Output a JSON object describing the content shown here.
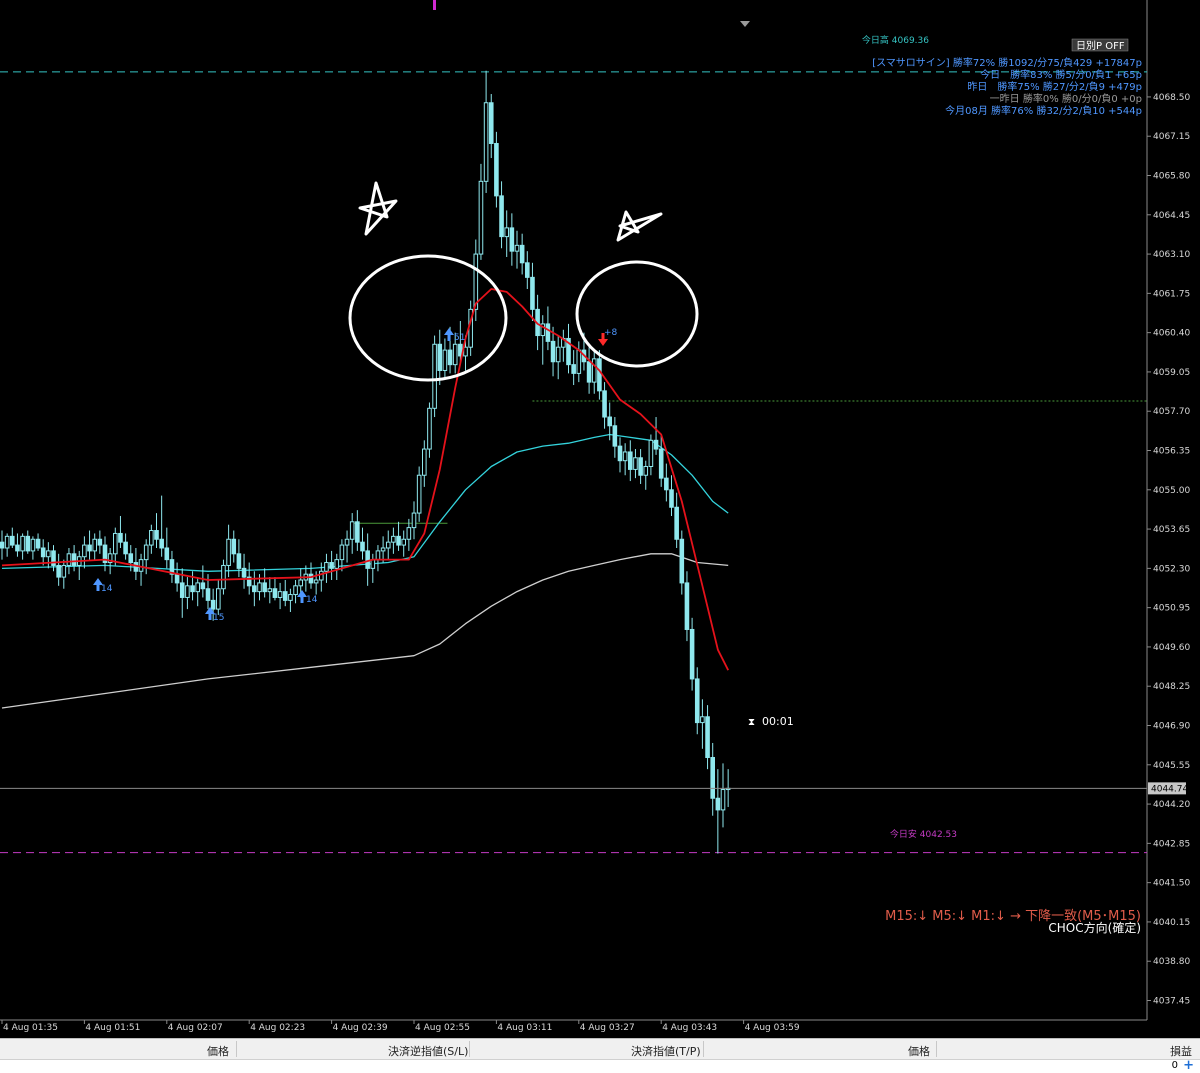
{
  "colors": {
    "background": "#000000",
    "candle": "#8fe8ee",
    "ma_fast": "#e5121b",
    "ma_mid": "#34d3dc",
    "ma_slow": "#cfcfcf",
    "day_high_line": "#35c3c3",
    "day_low_line": "#c43bc4",
    "buy_arrow": "#4f97ff",
    "sell_arrow": "#ff2a2a",
    "annotation": "#ffffff",
    "level_line": "#4a9a3a",
    "stats_text": "#4f97ff",
    "trend_text": "#e05c4a"
  },
  "top_controls": {
    "period_toggle": "日別P OFF"
  },
  "day_levels": {
    "high_label": "今日高 4069.36",
    "low_label": "今日安 4042.53"
  },
  "stats_panel": {
    "lines": [
      "[スマサロサイン] 勝率72% 勝1092/分75/負429 +17847p",
      "今日　勝率83% 勝5/分0/負1 +65p",
      "昨日　勝率75% 勝27/分2/負9 +479p",
      "一昨日 勝率0% 勝0/分0/負0 +0p",
      "今月08月 勝率76% 勝32/分2/負10 +544p"
    ]
  },
  "trend_panel": {
    "line1": "M15:↓ M5:↓ M1:↓ → 下降一致(M5･M15)",
    "line2": "CHOC方向(確定)"
  },
  "current_price_label": "4044.74",
  "countdown": "00:01",
  "signal_labels": {
    "buy_1": "14",
    "buy_2": "15",
    "buy_3": "14",
    "buy_4": "51",
    "sell_1": "+8"
  },
  "bottom_bar": {
    "col1": "価格",
    "col2": "決済逆指値(S/L)",
    "col3": "決済指値(T/P)",
    "col4": "価格",
    "col5": "損益",
    "profit_value": "0",
    "add_icon": "+"
  },
  "chart_data": {
    "type": "candlestick",
    "symbol_unit": "price",
    "price_ticks": [
      "4068.50",
      "4067.15",
      "4065.80",
      "4064.45",
      "4063.10",
      "4061.75",
      "4060.40",
      "4059.05",
      "4057.70",
      "4056.35",
      "4055.00",
      "4053.65",
      "4052.30",
      "4050.95",
      "4049.60",
      "4048.25",
      "4046.90",
      "4045.55",
      "4044.20",
      "4042.85",
      "4041.50",
      "4040.15",
      "4038.80",
      "4037.45"
    ],
    "ylim": [
      4036.78,
      4070.8
    ],
    "time_ticks": [
      "4 Aug 01:35",
      "4 Aug 01:51",
      "4 Aug 02:07",
      "4 Aug 02:23",
      "4 Aug 02:39",
      "4 Aug 02:55",
      "4 Aug 03:11",
      "4 Aug 03:27",
      "4 Aug 03:43",
      "4 Aug 03:59"
    ],
    "x_range_minutes": [
      "01:35",
      "04:08"
    ],
    "ohlc_minutes_from_0135": [
      [
        0,
        4053.2,
        4053.6,
        4052.6,
        4053.0
      ],
      [
        1,
        4053.0,
        4053.5,
        4052.7,
        4053.4
      ],
      [
        2,
        4053.4,
        4053.7,
        4053.0,
        4053.1
      ],
      [
        3,
        4053.1,
        4053.5,
        4052.7,
        4052.9
      ],
      [
        4,
        4052.9,
        4053.5,
        4052.6,
        4053.4
      ],
      [
        5,
        4053.4,
        4053.6,
        4052.8,
        4052.9
      ],
      [
        6,
        4052.9,
        4053.4,
        4052.6,
        4053.3
      ],
      [
        7,
        4053.3,
        4053.5,
        4052.9,
        4053.0
      ],
      [
        8,
        4053.0,
        4053.3,
        4052.4,
        4052.7
      ],
      [
        9,
        4052.7,
        4053.2,
        4052.3,
        4052.9
      ],
      [
        10,
        4052.9,
        4053.1,
        4052.2,
        4052.4
      ],
      [
        11,
        4052.4,
        4052.8,
        4051.7,
        4052.0
      ],
      [
        12,
        4052.0,
        4052.6,
        4051.6,
        4052.4
      ],
      [
        13,
        4052.4,
        4053.0,
        4052.1,
        4052.8
      ],
      [
        14,
        4052.8,
        4053.1,
        4052.2,
        4052.4
      ],
      [
        15,
        4052.4,
        4052.9,
        4051.9,
        4052.7
      ],
      [
        16,
        4052.7,
        4053.4,
        4052.3,
        4053.1
      ],
      [
        17,
        4053.1,
        4053.6,
        4052.6,
        4052.9
      ],
      [
        18,
        4052.9,
        4053.5,
        4052.6,
        4053.3
      ],
      [
        19,
        4053.3,
        4053.6,
        4052.8,
        4053.1
      ],
      [
        20,
        4053.1,
        4053.4,
        4052.2,
        4052.5
      ],
      [
        21,
        4052.5,
        4053.0,
        4052.1,
        4052.8
      ],
      [
        22,
        4052.8,
        4053.7,
        4052.4,
        4053.5
      ],
      [
        23,
        4053.5,
        4054.1,
        4053.0,
        4053.2
      ],
      [
        24,
        4053.2,
        4053.5,
        4052.6,
        4052.8
      ],
      [
        25,
        4052.8,
        4053.1,
        4052.2,
        4052.5
      ],
      [
        26,
        4052.5,
        4053.0,
        4051.9,
        4052.2
      ],
      [
        27,
        4052.2,
        4052.8,
        4051.7,
        4052.6
      ],
      [
        28,
        4052.6,
        4053.3,
        4052.1,
        4053.1
      ],
      [
        29,
        4053.1,
        4053.8,
        4052.8,
        4053.6
      ],
      [
        30,
        4053.6,
        4054.2,
        4053.0,
        4053.3
      ],
      [
        31,
        4053.3,
        4054.8,
        4052.7,
        4053.0
      ],
      [
        32,
        4053.0,
        4053.7,
        4052.3,
        4052.6
      ],
      [
        33,
        4052.6,
        4052.9,
        4051.8,
        4052.1
      ],
      [
        34,
        4052.1,
        4052.5,
        4051.5,
        4051.8
      ],
      [
        35,
        4051.8,
        4052.3,
        4050.6,
        4051.3
      ],
      [
        36,
        4051.3,
        4052.0,
        4050.9,
        4051.7
      ],
      [
        37,
        4051.7,
        4052.2,
        4051.2,
        4051.5
      ],
      [
        38,
        4051.5,
        4052.0,
        4051.0,
        4051.8
      ],
      [
        39,
        4051.8,
        4052.4,
        4051.3,
        4051.6
      ],
      [
        40,
        4051.6,
        4052.1,
        4050.9,
        4051.2
      ],
      [
        41,
        4051.2,
        4051.6,
        4050.5,
        4050.9
      ],
      [
        42,
        4050.9,
        4051.9,
        4050.7,
        4051.6
      ],
      [
        43,
        4051.6,
        4052.6,
        4051.4,
        4052.4
      ],
      [
        44,
        4052.4,
        4053.8,
        4052.0,
        4053.3
      ],
      [
        45,
        4053.3,
        4053.6,
        4052.5,
        4052.8
      ],
      [
        46,
        4052.8,
        4053.3,
        4052.0,
        4052.3
      ],
      [
        47,
        4052.3,
        4052.8,
        4051.6,
        4052.0
      ],
      [
        48,
        4052.0,
        4052.5,
        4051.4,
        4051.7
      ],
      [
        49,
        4051.7,
        4052.2,
        4051.0,
        4051.5
      ],
      [
        50,
        4051.5,
        4052.1,
        4051.2,
        4051.8
      ],
      [
        51,
        4051.8,
        4052.3,
        4051.3,
        4051.5
      ],
      [
        52,
        4051.5,
        4052.0,
        4051.1,
        4051.6
      ],
      [
        53,
        4051.6,
        4052.0,
        4051.2,
        4051.3
      ],
      [
        54,
        4051.3,
        4051.8,
        4050.9,
        4051.5
      ],
      [
        55,
        4051.5,
        4051.9,
        4051.0,
        4051.2
      ],
      [
        56,
        4051.2,
        4051.6,
        4050.8,
        4051.4
      ],
      [
        57,
        4051.4,
        4051.9,
        4051.1,
        4051.7
      ],
      [
        58,
        4051.7,
        4052.3,
        4051.3,
        4051.9
      ],
      [
        59,
        4051.9,
        4052.4,
        4051.5,
        4052.1
      ],
      [
        60,
        4052.1,
        4052.5,
        4051.6,
        4051.8
      ],
      [
        61,
        4051.8,
        4052.2,
        4051.4,
        4051.9
      ],
      [
        62,
        4051.9,
        4052.5,
        4051.5,
        4052.2
      ],
      [
        63,
        4052.2,
        4052.8,
        4051.8,
        4052.5
      ],
      [
        64,
        4052.5,
        4052.9,
        4051.9,
        4052.3
      ],
      [
        65,
        4052.3,
        4052.8,
        4051.9,
        4052.6
      ],
      [
        66,
        4052.6,
        4053.3,
        4052.2,
        4053.1
      ],
      [
        67,
        4053.1,
        4053.6,
        4052.5,
        4053.3
      ],
      [
        68,
        4053.3,
        4054.2,
        4052.8,
        4053.9
      ],
      [
        69,
        4053.9,
        4054.3,
        4052.9,
        4053.2
      ],
      [
        70,
        4053.2,
        4053.7,
        4052.6,
        4052.9
      ],
      [
        71,
        4052.9,
        4053.5,
        4051.7,
        4052.3
      ],
      [
        72,
        4052.3,
        4052.8,
        4051.8,
        4052.6
      ],
      [
        73,
        4052.6,
        4053.1,
        4052.2,
        4052.9
      ],
      [
        74,
        4052.9,
        4053.4,
        4052.5,
        4053.0
      ],
      [
        75,
        4053.0,
        4053.6,
        4052.6,
        4053.2
      ],
      [
        76,
        4053.2,
        4053.7,
        4052.8,
        4053.4
      ],
      [
        77,
        4053.4,
        4053.9,
        4052.9,
        4053.1
      ],
      [
        78,
        4053.1,
        4053.6,
        4052.7,
        4053.3
      ],
      [
        79,
        4053.3,
        4054.0,
        4052.9,
        4053.7
      ],
      [
        80,
        4053.7,
        4054.6,
        4053.3,
        4054.2
      ],
      [
        81,
        4054.2,
        4055.8,
        4053.9,
        4055.5
      ],
      [
        82,
        4055.5,
        4056.7,
        4055.1,
        4056.4
      ],
      [
        83,
        4056.4,
        4058.0,
        4056.1,
        4057.8
      ],
      [
        84,
        4057.8,
        4060.3,
        4057.5,
        4060.0
      ],
      [
        85,
        4060.0,
        4060.5,
        4058.6,
        4059.1
      ],
      [
        86,
        4059.1,
        4060.2,
        4058.8,
        4059.8
      ],
      [
        87,
        4059.8,
        4060.6,
        4059.0,
        4059.3
      ],
      [
        88,
        4059.3,
        4060.4,
        4059.0,
        4060.0
      ],
      [
        89,
        4060.0,
        4060.8,
        4059.4,
        4059.6
      ],
      [
        90,
        4059.6,
        4060.3,
        4059.1,
        4059.9
      ],
      [
        91,
        4059.9,
        4061.5,
        4059.6,
        4061.2
      ],
      [
        92,
        4061.2,
        4063.6,
        4060.8,
        4063.1
      ],
      [
        93,
        4063.1,
        4066.2,
        4062.9,
        4065.6
      ],
      [
        94,
        4065.6,
        4069.4,
        4065.2,
        4068.3
      ],
      [
        95,
        4068.3,
        4068.6,
        4066.4,
        4066.9
      ],
      [
        96,
        4066.9,
        4067.3,
        4064.7,
        4065.1
      ],
      [
        97,
        4065.1,
        4065.6,
        4063.3,
        4063.7
      ],
      [
        98,
        4063.7,
        4064.6,
        4063.0,
        4064.0
      ],
      [
        99,
        4064.0,
        4064.5,
        4062.7,
        4063.2
      ],
      [
        100,
        4063.2,
        4063.9,
        4062.6,
        4063.4
      ],
      [
        101,
        4063.4,
        4063.8,
        4062.4,
        4062.8
      ],
      [
        102,
        4062.8,
        4063.2,
        4061.9,
        4062.3
      ],
      [
        103,
        4062.3,
        4062.8,
        4060.8,
        4061.2
      ],
      [
        104,
        4061.2,
        4061.7,
        4059.8,
        4060.3
      ],
      [
        105,
        4060.3,
        4061.0,
        4059.3,
        4060.7
      ],
      [
        106,
        4060.7,
        4061.3,
        4059.8,
        4060.1
      ],
      [
        107,
        4060.1,
        4060.6,
        4058.9,
        4059.4
      ],
      [
        108,
        4059.4,
        4060.3,
        4058.8,
        4059.9
      ],
      [
        109,
        4059.9,
        4060.5,
        4059.4,
        4060.2
      ],
      [
        110,
        4060.2,
        4060.7,
        4059.0,
        4059.3
      ],
      [
        111,
        4059.3,
        4059.8,
        4058.6,
        4059.0
      ],
      [
        112,
        4059.0,
        4060.1,
        4058.7,
        4059.8
      ],
      [
        113,
        4059.8,
        4060.4,
        4059.1,
        4059.4
      ],
      [
        114,
        4059.4,
        4059.9,
        4058.3,
        4058.7
      ],
      [
        115,
        4058.7,
        4059.8,
        4058.3,
        4059.5
      ],
      [
        116,
        4059.5,
        4059.8,
        4058.1,
        4058.4
      ],
      [
        117,
        4058.4,
        4058.7,
        4057.1,
        4057.5
      ],
      [
        118,
        4057.5,
        4058.0,
        4056.7,
        4057.2
      ],
      [
        119,
        4057.2,
        4057.5,
        4056.1,
        4056.5
      ],
      [
        120,
        4056.5,
        4056.8,
        4055.6,
        4056.0
      ],
      [
        121,
        4056.0,
        4056.6,
        4055.5,
        4056.3
      ],
      [
        122,
        4056.3,
        4056.7,
        4055.3,
        4055.7
      ],
      [
        123,
        4055.7,
        4056.4,
        4055.4,
        4056.1
      ],
      [
        124,
        4056.1,
        4056.4,
        4055.2,
        4055.5
      ],
      [
        125,
        4055.5,
        4056.0,
        4055.0,
        4055.8
      ],
      [
        126,
        4055.8,
        4056.9,
        4055.5,
        4056.7
      ],
      [
        127,
        4056.7,
        4057.5,
        4056.2,
        4056.4
      ],
      [
        128,
        4056.4,
        4056.9,
        4055.1,
        4055.4
      ],
      [
        129,
        4055.4,
        4055.9,
        4054.6,
        4055.0
      ],
      [
        130,
        4055.0,
        4055.5,
        4054.1,
        4054.4
      ],
      [
        131,
        4054.4,
        4054.9,
        4053.0,
        4053.3
      ],
      [
        132,
        4053.3,
        4053.6,
        4051.4,
        4051.8
      ],
      [
        133,
        4051.8,
        4052.2,
        4049.8,
        4050.2
      ],
      [
        134,
        4050.2,
        4050.6,
        4048.1,
        4048.5
      ],
      [
        135,
        4048.5,
        4048.9,
        4046.6,
        4047.0
      ],
      [
        136,
        4047.0,
        4047.8,
        4046.1,
        4047.2
      ],
      [
        137,
        4047.2,
        4047.6,
        4045.4,
        4045.8
      ],
      [
        138,
        4045.8,
        4046.3,
        4043.8,
        4044.4
      ],
      [
        139,
        4044.4,
        4045.4,
        4042.5,
        4044.0
      ],
      [
        140,
        4044.0,
        4045.6,
        4043.4,
        4044.7
      ],
      [
        141,
        4044.7,
        4045.4,
        4044.1,
        4044.74
      ]
    ],
    "ma_fast": [
      [
        0,
        4052.4
      ],
      [
        20,
        4052.6
      ],
      [
        40,
        4051.9
      ],
      [
        60,
        4052.0
      ],
      [
        72,
        4052.6
      ],
      [
        79,
        4052.6
      ],
      [
        82,
        4053.5
      ],
      [
        85,
        4055.7
      ],
      [
        88,
        4058.5
      ],
      [
        90,
        4060.2
      ],
      [
        92,
        4061.4
      ],
      [
        95,
        4061.9
      ],
      [
        98,
        4061.8
      ],
      [
        101,
        4061.3
      ],
      [
        104,
        4060.7
      ],
      [
        108,
        4060.3
      ],
      [
        112,
        4059.8
      ],
      [
        116,
        4059.1
      ],
      [
        120,
        4058.1
      ],
      [
        124,
        4057.6
      ],
      [
        128,
        4056.9
      ],
      [
        132,
        4054.6
      ],
      [
        136,
        4051.7
      ],
      [
        139,
        4049.5
      ],
      [
        141,
        4048.8
      ]
    ],
    "ma_mid": [
      [
        0,
        4052.3
      ],
      [
        20,
        4052.4
      ],
      [
        40,
        4052.2
      ],
      [
        60,
        4052.3
      ],
      [
        75,
        4052.5
      ],
      [
        80,
        4052.7
      ],
      [
        85,
        4053.9
      ],
      [
        90,
        4055.0
      ],
      [
        95,
        4055.8
      ],
      [
        100,
        4056.3
      ],
      [
        105,
        4056.5
      ],
      [
        110,
        4056.6
      ],
      [
        115,
        4056.8
      ],
      [
        118,
        4056.9
      ],
      [
        122,
        4056.8
      ],
      [
        126,
        4056.7
      ],
      [
        130,
        4056.2
      ],
      [
        134,
        4055.5
      ],
      [
        138,
        4054.6
      ],
      [
        141,
        4054.2
      ]
    ],
    "ma_slow": [
      [
        0,
        4047.5
      ],
      [
        20,
        4048.0
      ],
      [
        40,
        4048.5
      ],
      [
        60,
        4048.9
      ],
      [
        80,
        4049.3
      ],
      [
        85,
        4049.7
      ],
      [
        90,
        4050.4
      ],
      [
        95,
        4051.0
      ],
      [
        100,
        4051.5
      ],
      [
        105,
        4051.9
      ],
      [
        110,
        4052.2
      ],
      [
        115,
        4052.4
      ],
      [
        120,
        4052.6
      ],
      [
        126,
        4052.8
      ],
      [
        130,
        4052.8
      ],
      [
        135,
        4052.5
      ],
      [
        141,
        4052.4
      ]
    ],
    "day_high": 4069.36,
    "day_low": 4042.53,
    "current_price": 4044.74,
    "grid": false,
    "legend": "none"
  }
}
